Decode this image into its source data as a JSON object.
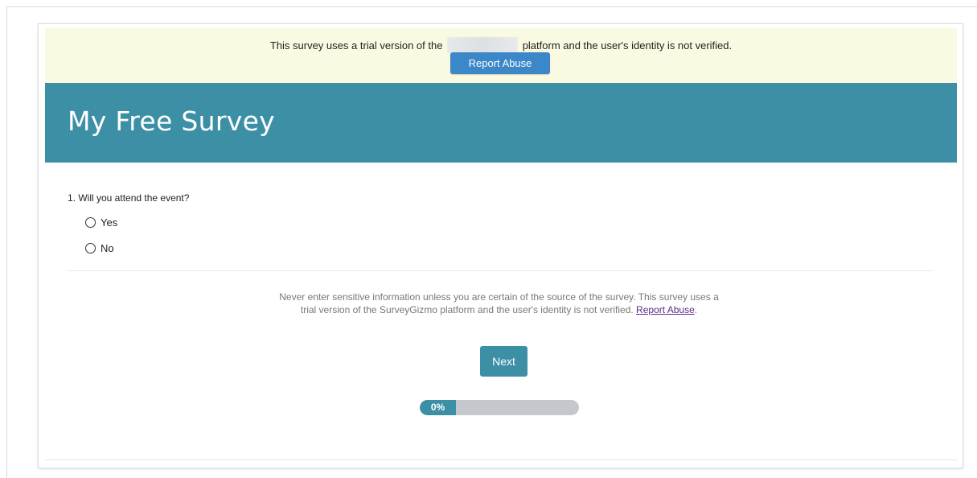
{
  "trial_banner": {
    "text_before": "This survey uses a trial version of the",
    "text_after": "platform and the user's identity is not verified.",
    "report_abuse_label": "Report Abuse"
  },
  "header": {
    "title": "My Free Survey"
  },
  "question": {
    "text": "1. Will you attend the event?",
    "options": [
      {
        "label": "Yes",
        "selected": false
      },
      {
        "label": "No",
        "selected": false
      }
    ]
  },
  "disclaimer": {
    "text": "Never enter sensitive information unless you are certain of the source of the survey. This survey uses a trial version of the SurveyGizmo platform and the user's identity is not verified.",
    "link_label": "Report Abuse",
    "after_link": "."
  },
  "navigation": {
    "next_label": "Next"
  },
  "progress": {
    "label": "0%",
    "value": 0
  },
  "colors": {
    "header_bg": "#3d8fa6",
    "banner_bg": "#fafae3",
    "report_button_bg": "#3b87c8",
    "progress_track": "#c4c8cc"
  }
}
